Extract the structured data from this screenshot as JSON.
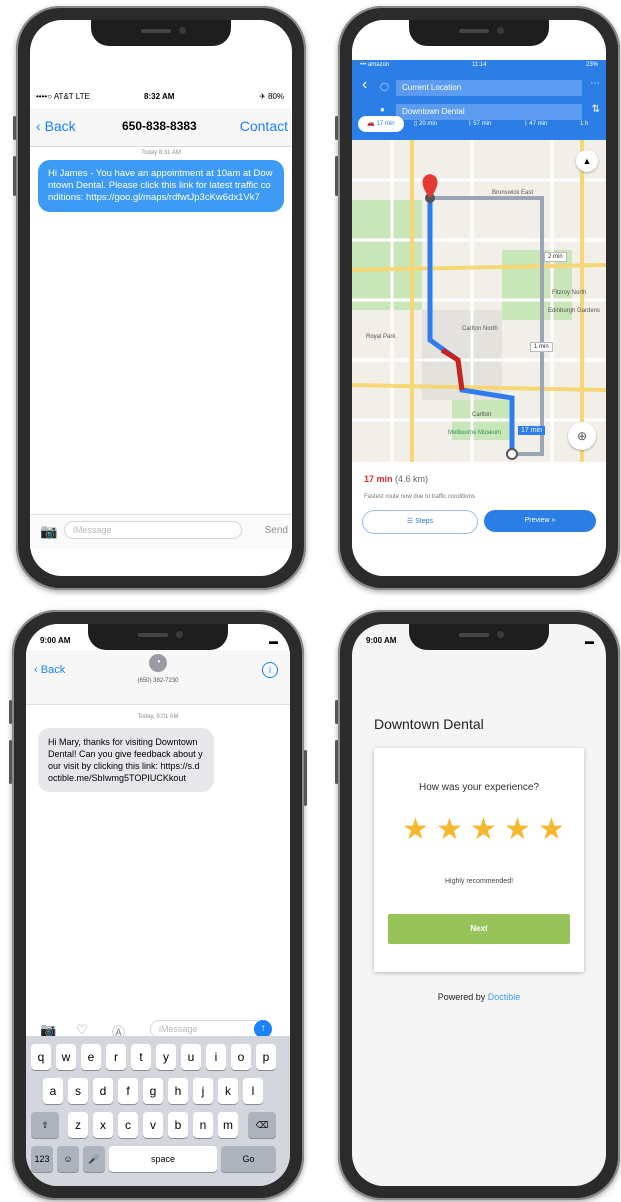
{
  "phone1": {
    "status": {
      "carrier": "••••○ AT&T LTE",
      "time": "8:32 AM",
      "battery": "✈ 80%"
    },
    "nav": {
      "back": "Back",
      "title": "650-838-8383",
      "contact": "Contact"
    },
    "timestamp": "Today 8:31 AM",
    "message": "Hi James - You have an appointment at 10am at Downtown Dental. Please click this link for latest traffic conditions: https://goo.gl/maps/rdfwtJp3cKw6dx1Vk7",
    "input_placeholder": "iMessage",
    "send": "Send"
  },
  "phone2": {
    "status": {
      "carrier": "••• amazon",
      "time": "11:14",
      "battery": "23%"
    },
    "from": "Current Location",
    "to": "Downtown Dental",
    "modes": [
      "17 min",
      "20 min",
      "57 min",
      "47 min",
      "1 h"
    ],
    "map_labels": [
      "Brunswick East",
      "Fitzroy North",
      "Edinburgh Gardens",
      "Royal Park",
      "Carlton North",
      "Carlton",
      "Melbourne Museum"
    ],
    "route_badges": [
      "17 min",
      "2 min",
      "1 min"
    ],
    "eta": "17 min",
    "distance": "(4.6 km)",
    "note": "Fastest route now due to traffic conditions",
    "steps": "Steps",
    "preview": "Preview"
  },
  "phone3": {
    "status": {
      "time": "9:00 AM"
    },
    "nav": {
      "back": "Back",
      "number": "(650) 382-7230"
    },
    "timestamp": "Today, 9:01 AM",
    "message": "Hi Mary, thanks for visiting Downtown Dental! Can you give feedback about your visit by clicking this link: https://s.doctible.me/SbIwmg5TOPIUCKkout",
    "input_placeholder": "iMessage",
    "keys_row1": [
      "q",
      "w",
      "e",
      "r",
      "t",
      "y",
      "u",
      "i",
      "o",
      "p"
    ],
    "keys_row2": [
      "a",
      "s",
      "d",
      "f",
      "g",
      "h",
      "j",
      "k",
      "l"
    ],
    "keys_row3": [
      "z",
      "x",
      "c",
      "v",
      "b",
      "n",
      "m"
    ],
    "key_123": "123",
    "key_space": "space",
    "key_go": "Go"
  },
  "phone4": {
    "status": {
      "time": "9:00 AM"
    },
    "practice": "Downtown Dental",
    "question": "How was your experience?",
    "rating": 5,
    "rating_text": "Highly recommended!",
    "next": "Next",
    "powered_prefix": "Powered by ",
    "powered_brand": "Doctible"
  },
  "colors": {
    "imessage_blue": "#3d9bf5",
    "maps_blue": "#2a7ee6",
    "star_gold": "#f5b82e",
    "next_green": "#96c45b",
    "doctible_blue": "#3d9bf5"
  }
}
